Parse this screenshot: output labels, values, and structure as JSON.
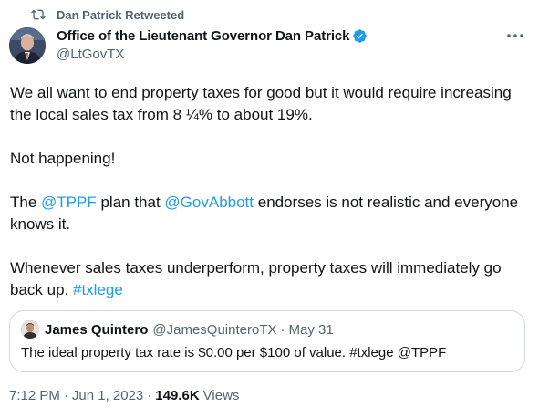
{
  "retweet": {
    "label": "Dan Patrick Retweeted",
    "icon": "retweet-icon"
  },
  "author": {
    "display_name": "Office of the Lieutenant Governor Dan Patrick",
    "handle": "@LtGovTX",
    "verified": true,
    "verified_icon": "verified-badge-icon",
    "avatar_icon": "avatar-photo"
  },
  "more_icon": "more-horizontal-icon",
  "tweet": {
    "para1": "We all want to end property taxes for good but it would require increasing the local sales tax from 8 ¼% to about 19%.",
    "para2": "Not happening!",
    "para3_pre": "The ",
    "para3_link1": "@TPPF",
    "para3_mid": " plan that ",
    "para3_link2": "@GovAbbott",
    "para3_post": " endorses is not realistic and everyone knows it.",
    "para4_pre": "Whenever sales taxes underperform, property taxes will immediately go back up. ",
    "para4_link": "#txlege"
  },
  "quote": {
    "display_name": "James Quintero",
    "handle": "@JamesQuinteroTX",
    "dot": "·",
    "date": "May 31",
    "text": "The ideal property tax rate is $0.00 per $100 of value. #txlege @TPPF"
  },
  "meta": {
    "time": "7:12 PM",
    "sep1": "·",
    "date": "Jun 1, 2023",
    "sep2": "·",
    "views_count": "149.6K",
    "views_label": "Views"
  },
  "colors": {
    "text": "#0f1419",
    "secondary": "#536471",
    "link": "#1d9bf0",
    "border": "#cfd9de"
  }
}
